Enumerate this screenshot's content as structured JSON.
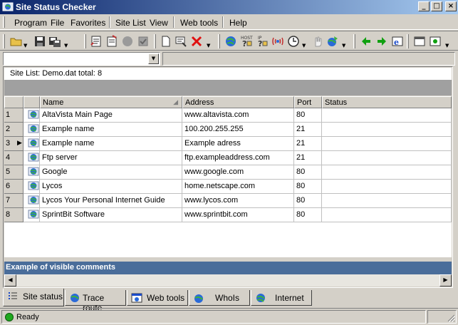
{
  "window": {
    "title": "Site Status Checker",
    "controls": {
      "minimize": "_",
      "maximize": "□",
      "close": "×"
    }
  },
  "menu": {
    "items": [
      "Program",
      "File",
      "Favorites",
      "Site List",
      "View",
      "Web tools",
      "Help"
    ]
  },
  "toolbar": {
    "icons": [
      "open-folder-icon",
      "save-icon",
      "save-as-icon",
      "edit-list-icon",
      "new-list-icon",
      "stop-icon",
      "check-icon",
      "new-document-icon",
      "properties-icon",
      "delete-icon",
      "globe-check-icon",
      "host-query-icon",
      "ip-query-icon",
      "ping-icon",
      "schedule-icon",
      "hand-icon",
      "network-icon",
      "back-arrow-icon",
      "forward-arrow-icon",
      "browser-icon",
      "window-icon",
      "settings-icon"
    ]
  },
  "sitelist": {
    "label": "Site List:",
    "file": "Demo.dat",
    "total_label": "total:",
    "total": "8"
  },
  "grid": {
    "columns": [
      "Name",
      "Address",
      "Port",
      "Status"
    ],
    "rows": [
      {
        "num": "1",
        "name": "AltaVista Main Page",
        "address": "www.altavista.com",
        "port": "80",
        "status": ""
      },
      {
        "num": "2",
        "name": "Example name",
        "address": "100.200.255.255",
        "port": "21",
        "status": ""
      },
      {
        "num": "3",
        "name": "Example name",
        "address": "Example adress",
        "port": "21",
        "status": ""
      },
      {
        "num": "4",
        "name": "Ftp server",
        "address": "ftp.exampleaddress.com",
        "port": "21",
        "status": ""
      },
      {
        "num": "5",
        "name": "Google",
        "address": "www.google.com",
        "port": "80",
        "status": ""
      },
      {
        "num": "6",
        "name": "Lycos",
        "address": "home.netscape.com",
        "port": "80",
        "status": ""
      },
      {
        "num": "7",
        "name": "Lycos Your Personal Internet Guide",
        "address": "www.lycos.com",
        "port": "80",
        "status": ""
      },
      {
        "num": "8",
        "name": "SprintBit Software",
        "address": "www.sprintbit.com",
        "port": "80",
        "status": ""
      }
    ],
    "current_row": "3"
  },
  "comments": {
    "text": "Example of visible comments"
  },
  "tabs": [
    {
      "label": "Site status",
      "active": true
    },
    {
      "label": "Trace route",
      "active": false
    },
    {
      "label": "Web tools",
      "active": false
    },
    {
      "label": "WhoIs",
      "active": false
    },
    {
      "label": "Internet",
      "active": false
    }
  ],
  "status": {
    "text": "Ready",
    "indicator_color": "#1fa81f"
  },
  "colors": {
    "title_start": "#0a246a",
    "title_end": "#a6caf0",
    "comments_bar": "#4a6d9a",
    "face": "#d4d0c8"
  }
}
